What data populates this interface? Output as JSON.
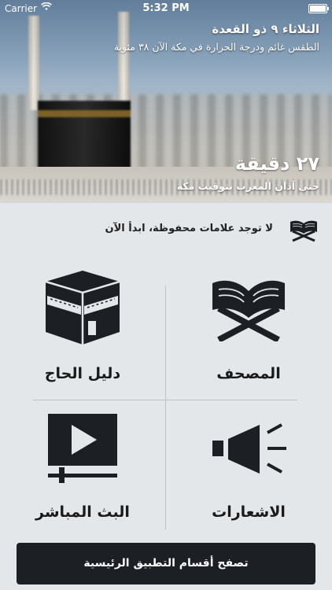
{
  "status_bar": {
    "carrier": "Carrier",
    "wifi_icon": "wifi-icon",
    "time": "5:32 PM",
    "battery_level": 1.0
  },
  "header": {
    "date": "الثلاثاء ٩ ذو القعدة",
    "weather": "الطقس غائم ودرجة الحرارة في مكة الآن ٣٨ مئوية",
    "countdown": "٢٧ دقيقة",
    "countdown_caption": "حتى آذان المغرب بتوقيت مكة"
  },
  "bookmarks": {
    "icon": "quran-stand-icon",
    "label": "لا توجد علامات محفوظة، ابدأ الآن"
  },
  "menu": {
    "mushaf": {
      "label": "المصحف",
      "icon": "quran-book-icon"
    },
    "hajj_guide": {
      "label": "دليل الحاج",
      "icon": "kaaba-icon"
    },
    "notifications": {
      "label": "الاشعارات",
      "icon": "speaker-icon"
    },
    "live_stream": {
      "label": "البث المباشر",
      "icon": "video-play-icon"
    }
  },
  "footer": {
    "browse_label": "تصفح أقسام التطبيق الرئيسية"
  },
  "colors": {
    "background": "#e4e7ea",
    "icon_dark": "#1c1f24",
    "divider": "#bfc4c8"
  }
}
